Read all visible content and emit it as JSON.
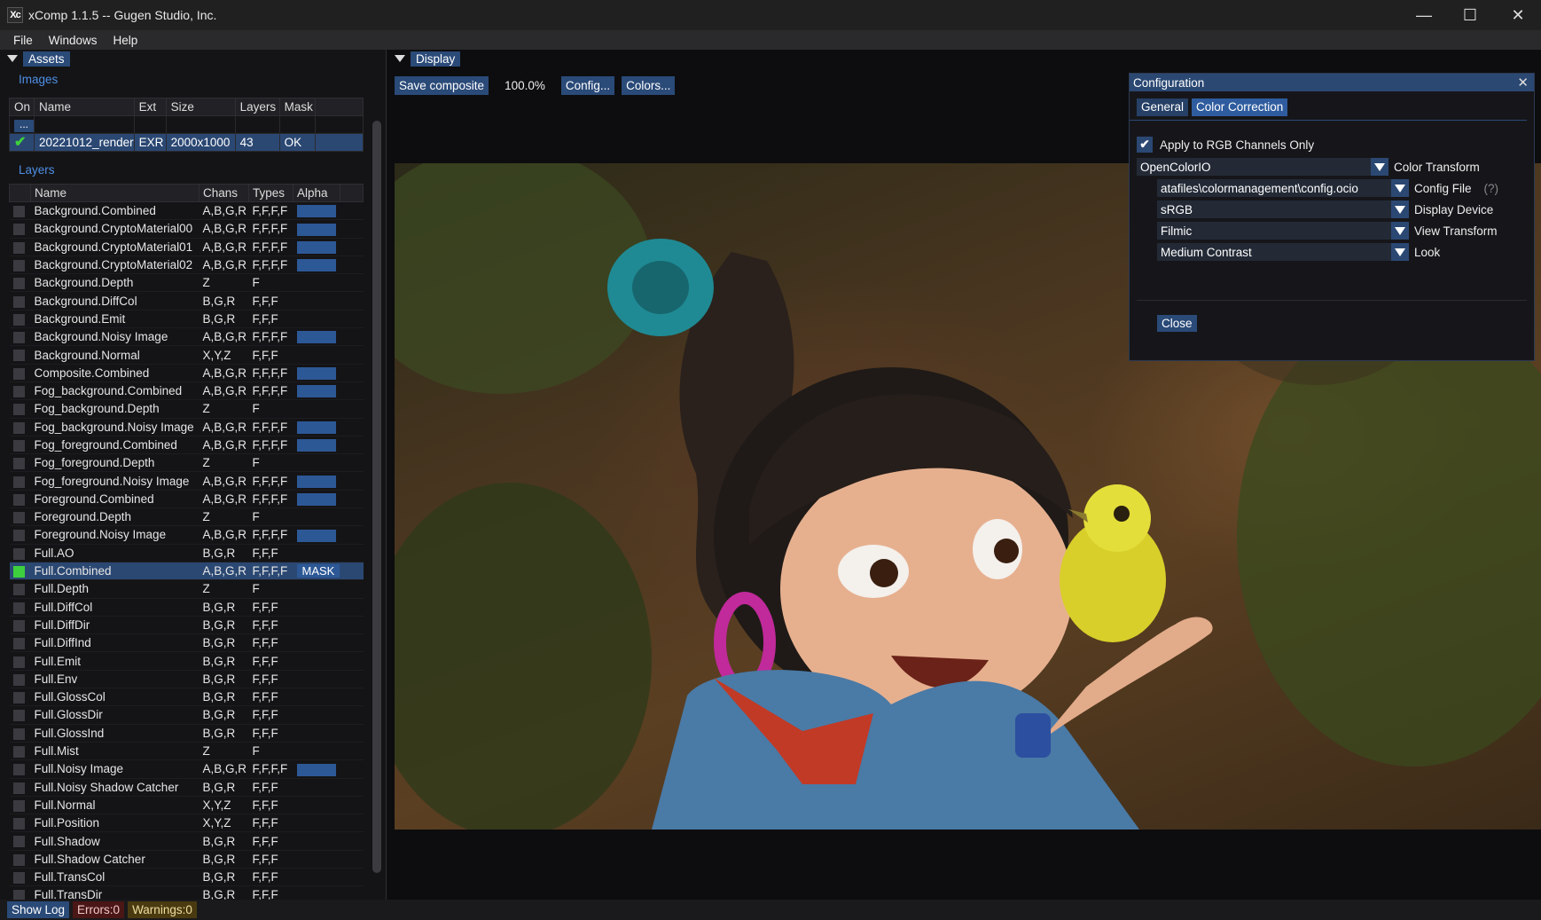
{
  "window": {
    "title": "xComp 1.1.5 -- Gugen Studio, Inc.",
    "icon": "xc-app-icon",
    "min": "—",
    "max": "☐",
    "close": "✕"
  },
  "menu": [
    "File",
    "Windows",
    "Help"
  ],
  "assets": {
    "tab": "Assets",
    "images_title": "Images",
    "images_headers": [
      "On",
      "Name",
      "Ext",
      "Size",
      "Layers",
      "Mask"
    ],
    "add_button": "...",
    "image_row": {
      "name": "20221012_render",
      "ext": "EXR",
      "size": "2000x1000",
      "layers": "43",
      "mask": "OK"
    },
    "layers_title": "Layers",
    "layers_headers": [
      "Name",
      "Chans",
      "Types",
      "Alpha"
    ],
    "layers": [
      {
        "name": "Background.Combined",
        "chans": "A,B,G,R",
        "types": "F,F,F,F",
        "alpha": true
      },
      {
        "name": "Background.CryptoMaterial00",
        "chans": "A,B,G,R",
        "types": "F,F,F,F",
        "alpha": true
      },
      {
        "name": "Background.CryptoMaterial01",
        "chans": "A,B,G,R",
        "types": "F,F,F,F",
        "alpha": true
      },
      {
        "name": "Background.CryptoMaterial02",
        "chans": "A,B,G,R",
        "types": "F,F,F,F",
        "alpha": true
      },
      {
        "name": "Background.Depth",
        "chans": "Z",
        "types": "F",
        "alpha": false
      },
      {
        "name": "Background.DiffCol",
        "chans": "B,G,R",
        "types": "F,F,F",
        "alpha": false
      },
      {
        "name": "Background.Emit",
        "chans": "B,G,R",
        "types": "F,F,F",
        "alpha": false
      },
      {
        "name": "Background.Noisy Image",
        "chans": "A,B,G,R",
        "types": "F,F,F,F",
        "alpha": true
      },
      {
        "name": "Background.Normal",
        "chans": "X,Y,Z",
        "types": "F,F,F",
        "alpha": false
      },
      {
        "name": "Composite.Combined",
        "chans": "A,B,G,R",
        "types": "F,F,F,F",
        "alpha": true
      },
      {
        "name": "Fog_background.Combined",
        "chans": "A,B,G,R",
        "types": "F,F,F,F",
        "alpha": true
      },
      {
        "name": "Fog_background.Depth",
        "chans": "Z",
        "types": "F",
        "alpha": false
      },
      {
        "name": "Fog_background.Noisy Image",
        "chans": "A,B,G,R",
        "types": "F,F,F,F",
        "alpha": true
      },
      {
        "name": "Fog_foreground.Combined",
        "chans": "A,B,G,R",
        "types": "F,F,F,F",
        "alpha": true
      },
      {
        "name": "Fog_foreground.Depth",
        "chans": "Z",
        "types": "F",
        "alpha": false
      },
      {
        "name": "Fog_foreground.Noisy Image",
        "chans": "A,B,G,R",
        "types": "F,F,F,F",
        "alpha": true
      },
      {
        "name": "Foreground.Combined",
        "chans": "A,B,G,R",
        "types": "F,F,F,F",
        "alpha": true
      },
      {
        "name": "Foreground.Depth",
        "chans": "Z",
        "types": "F",
        "alpha": false
      },
      {
        "name": "Foreground.Noisy Image",
        "chans": "A,B,G,R",
        "types": "F,F,F,F",
        "alpha": true
      },
      {
        "name": "Full.AO",
        "chans": "B,G,R",
        "types": "F,F,F",
        "alpha": false
      },
      {
        "name": "Full.Combined",
        "chans": "A,B,G,R",
        "types": "F,F,F,F",
        "alpha": false,
        "selected": true,
        "mask": "MASK"
      },
      {
        "name": "Full.Depth",
        "chans": "Z",
        "types": "F",
        "alpha": false
      },
      {
        "name": "Full.DiffCol",
        "chans": "B,G,R",
        "types": "F,F,F",
        "alpha": false
      },
      {
        "name": "Full.DiffDir",
        "chans": "B,G,R",
        "types": "F,F,F",
        "alpha": false
      },
      {
        "name": "Full.DiffInd",
        "chans": "B,G,R",
        "types": "F,F,F",
        "alpha": false
      },
      {
        "name": "Full.Emit",
        "chans": "B,G,R",
        "types": "F,F,F",
        "alpha": false
      },
      {
        "name": "Full.Env",
        "chans": "B,G,R",
        "types": "F,F,F",
        "alpha": false
      },
      {
        "name": "Full.GlossCol",
        "chans": "B,G,R",
        "types": "F,F,F",
        "alpha": false
      },
      {
        "name": "Full.GlossDir",
        "chans": "B,G,R",
        "types": "F,F,F",
        "alpha": false
      },
      {
        "name": "Full.GlossInd",
        "chans": "B,G,R",
        "types": "F,F,F",
        "alpha": false
      },
      {
        "name": "Full.Mist",
        "chans": "Z",
        "types": "F",
        "alpha": false
      },
      {
        "name": "Full.Noisy Image",
        "chans": "A,B,G,R",
        "types": "F,F,F,F",
        "alpha": true
      },
      {
        "name": "Full.Noisy Shadow Catcher",
        "chans": "B,G,R",
        "types": "F,F,F",
        "alpha": false
      },
      {
        "name": "Full.Normal",
        "chans": "X,Y,Z",
        "types": "F,F,F",
        "alpha": false
      },
      {
        "name": "Full.Position",
        "chans": "X,Y,Z",
        "types": "F,F,F",
        "alpha": false
      },
      {
        "name": "Full.Shadow",
        "chans": "B,G,R",
        "types": "F,F,F",
        "alpha": false
      },
      {
        "name": "Full.Shadow Catcher",
        "chans": "B,G,R",
        "types": "F,F,F",
        "alpha": false
      },
      {
        "name": "Full.TransCol",
        "chans": "B,G,R",
        "types": "F,F,F",
        "alpha": false
      },
      {
        "name": "Full.TransDir",
        "chans": "B,G,R",
        "types": "F,F,F",
        "alpha": false
      }
    ]
  },
  "display": {
    "tab": "Display",
    "save_composite": "Save composite",
    "zoom": "100.0%",
    "config": "Config...",
    "colors": "Colors..."
  },
  "configuration": {
    "title": "Configuration",
    "close_x": "✕",
    "tabs": [
      "General",
      "Color Correction"
    ],
    "apply_rgb": "Apply to RGB Channels Only",
    "color_transform_value": "OpenColorIO",
    "color_transform_label": "Color Transform",
    "config_file_value": "atafiles\\colormanagement\\config.ocio",
    "config_file_label": "Config File",
    "config_file_help": "(?)",
    "display_device_value": "sRGB",
    "display_device_label": "Display Device",
    "view_transform_value": "Filmic",
    "view_transform_label": "View Transform",
    "look_value": "Medium Contrast",
    "look_label": "Look",
    "close_button": "Close"
  },
  "status": {
    "show_log": "Show Log",
    "errors": "Errors:0",
    "warnings": "Warnings:0"
  }
}
